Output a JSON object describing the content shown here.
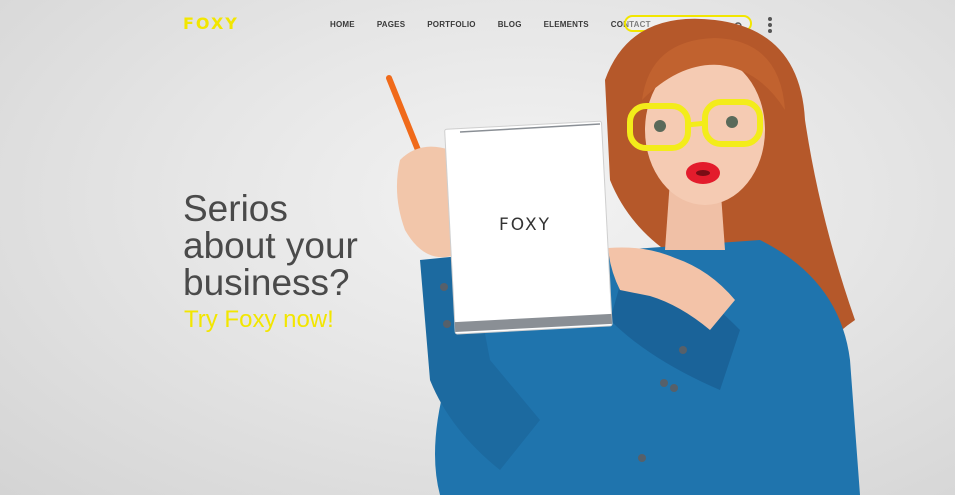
{
  "brand": {
    "logo_text": "FOXY",
    "accent_color": "#f2e600"
  },
  "nav": {
    "items": [
      {
        "label": "HOME"
      },
      {
        "label": "PAGES"
      },
      {
        "label": "PORTFOLIO"
      },
      {
        "label": "BLOG"
      },
      {
        "label": "ELEMENTS"
      },
      {
        "label": "CONTACT"
      }
    ]
  },
  "search": {
    "placeholder": "",
    "icon": "search-icon"
  },
  "menu": {
    "icon": "more-vertical-icon"
  },
  "hero": {
    "headline_line1": "Serios",
    "headline_line2": "about your",
    "headline_line3": "business?",
    "cta_label": "Try Foxy now!",
    "notepad_text": "FOXY"
  }
}
